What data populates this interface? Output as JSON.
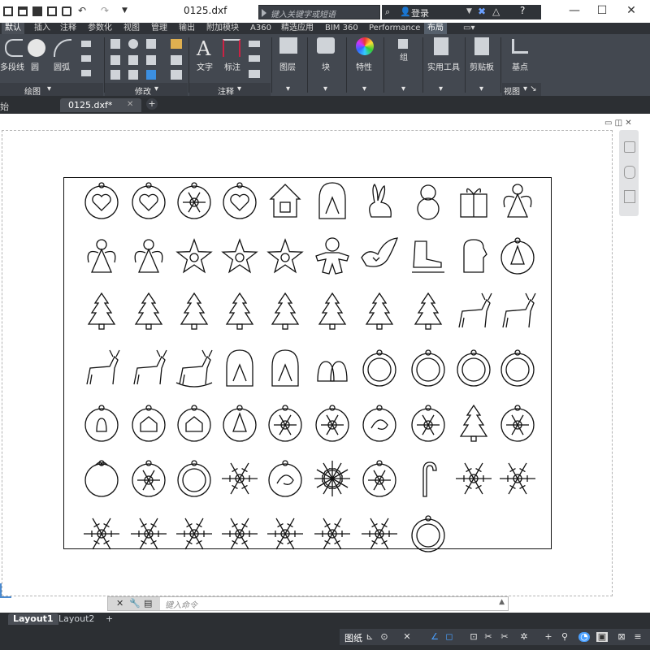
{
  "window": {
    "title": "0125.dxf",
    "search_placeholder": "键入关键字或短语",
    "login_label": "登录",
    "minimize": "—",
    "maximize": "☐",
    "close": "✕"
  },
  "ribbon_tabs": [
    "默认",
    "插入",
    "注释",
    "参数化",
    "视图",
    "管理",
    "输出",
    "附加模块",
    "A360",
    "精选应用",
    "BIM 360",
    "Performance",
    "布局"
  ],
  "active_tab": "默认",
  "ribbon": {
    "draw_tools": [
      "多段线",
      "圆",
      "圆弧"
    ],
    "panel_draw": "绘图",
    "panel_modify": "修改",
    "annotation_tools": [
      "文字",
      "标注"
    ],
    "panel_annotation": "注释",
    "big_buttons": [
      "图层",
      "块",
      "特性",
      "组",
      "实用工具",
      "剪贴板",
      "基点"
    ],
    "panel_view": "视图"
  },
  "doc_tabs": {
    "start_fragment": "始",
    "file_tab": "0125.dxf*",
    "add": "+"
  },
  "command_line": {
    "placeholder": "键入命令"
  },
  "layout_tabs": [
    "Layout1",
    "Layout2"
  ],
  "active_layout": "Layout1",
  "status_bar": {
    "paper_label": "图纸"
  },
  "ornaments": [
    [
      "heart-circle",
      "heart-circle",
      "snowflake-circle",
      "heart-circle",
      "house",
      "window-arch",
      "rabbit",
      "snowman",
      "gift-box",
      "angel"
    ],
    [
      "angel-bell",
      "angel",
      "star",
      "star",
      "star",
      "gingerbread",
      "dove",
      "skate",
      "mitten",
      "tree-circle"
    ],
    [
      "pine-tree",
      "pine-tree",
      "pine-tree",
      "pine-tree",
      "pine-tree",
      "pine-tree",
      "pine-tree",
      "house-tree",
      "reindeer",
      "reindeer"
    ],
    [
      "reindeer",
      "reindeer",
      "rocking-horse",
      "bell",
      "snow-globe",
      "bells",
      "ball",
      "ball",
      "ball",
      "ball"
    ],
    [
      "ball-bells",
      "ball-village",
      "ball-house",
      "ball-tree",
      "snowflake-ball",
      "snowflake-ball",
      "swirl-ball",
      "snowflake-ball",
      "tree-ornament",
      "snowflake-ball"
    ],
    [
      "ball-bow",
      "snowflake-ball",
      "ball-plain",
      "snowflake",
      "swirl-ball",
      "sun",
      "flower-frame",
      "candy-cane",
      "snowflake",
      "snowflake"
    ],
    [
      "snowflake",
      "snowflake",
      "snowflake",
      "snowflake",
      "snowflake",
      "snowflake",
      "snowflake",
      "ballerina"
    ]
  ]
}
